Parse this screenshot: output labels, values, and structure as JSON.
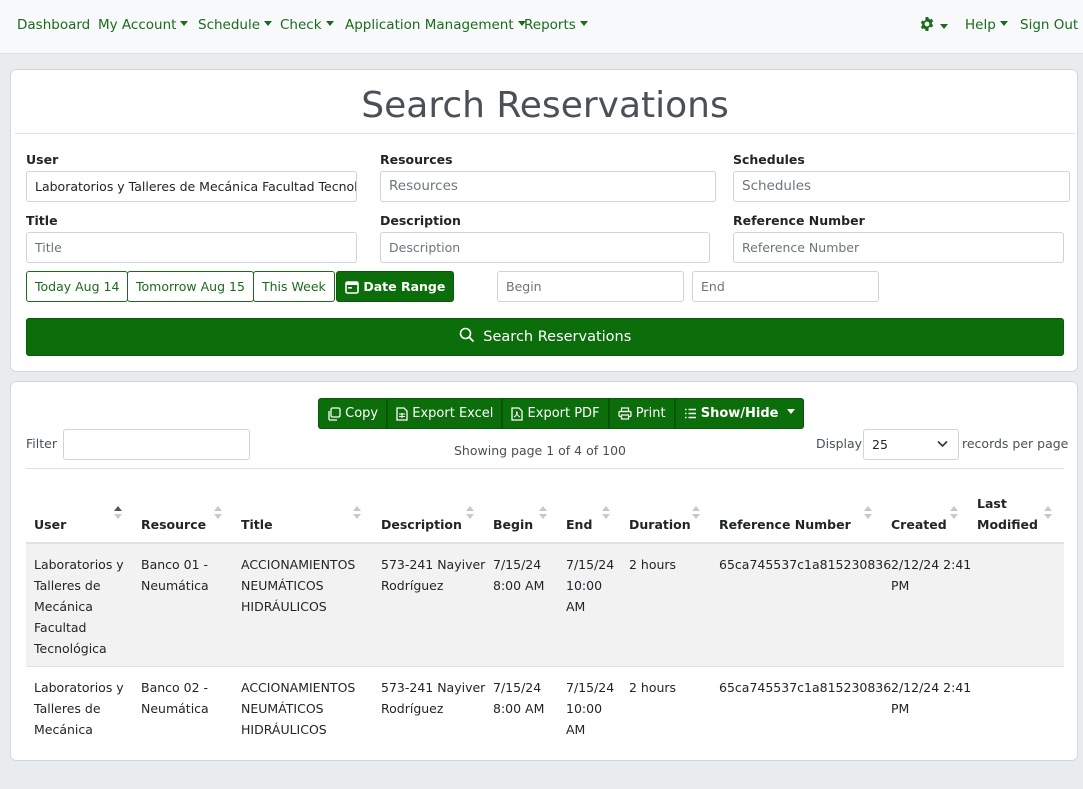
{
  "nav": {
    "dashboard": "Dashboard",
    "my_account": "My Account",
    "schedule": "Schedule",
    "check": "Check",
    "app_mgmt": "Application Management",
    "reports": "Reports",
    "help": "Help",
    "sign_out": "Sign Out"
  },
  "search": {
    "title": "Search Reservations",
    "user_label": "User",
    "user_value": "Laboratorios y Talleres de Mecánica Facultad Tecnológica",
    "resources_label": "Resources",
    "resources_placeholder": "Resources",
    "schedules_label": "Schedules",
    "schedules_placeholder": "Schedules",
    "title_label": "Title",
    "title_placeholder": "Title",
    "description_label": "Description",
    "description_placeholder": "Description",
    "refnum_label": "Reference Number",
    "refnum_placeholder": "Reference Number",
    "today": "Today Aug 14",
    "tomorrow": "Tomorrow Aug 15",
    "this_week": "This Week",
    "date_range": "Date Range",
    "begin_placeholder": "Begin",
    "end_placeholder": "End",
    "search_button": "Search Reservations"
  },
  "results": {
    "toolbar": {
      "copy": "Copy",
      "export_excel": "Export Excel",
      "export_pdf": "Export PDF",
      "print": "Print",
      "show_hide": "Show/Hide"
    },
    "filter_label": "Filter",
    "showing": "Showing page 1 of 4 of 100",
    "display_label": "Display",
    "display_value": "25",
    "records_per_page": "records per page",
    "columns": {
      "user": "User",
      "resource": "Resource",
      "title": "Title",
      "description": "Description",
      "begin": "Begin",
      "end": "End",
      "duration": "Duration",
      "reference": "Reference Number",
      "created": "Created",
      "last_modified_1": "Last",
      "last_modified_2": "Modified"
    },
    "rows": [
      {
        "user": [
          "Laboratorios y",
          "Talleres de",
          "Mecánica",
          "Facultad",
          "Tecnológica"
        ],
        "resource": [
          "Banco 01 -",
          "Neumática"
        ],
        "title": [
          "ACCIONAMIENTOS",
          "NEUMÁTICOS",
          "HIDRÁULICOS"
        ],
        "description": [
          "573-241 Nayiver",
          "Rodríguez"
        ],
        "begin": [
          "7/15/24",
          "8:00 AM"
        ],
        "end": [
          "7/15/24",
          "10:00",
          "AM"
        ],
        "duration": "2 hours",
        "reference": "65ca745537c1a815230836",
        "created": [
          "2/12/24 2:41",
          "PM"
        ],
        "last_modified": ""
      },
      {
        "user": [
          "Laboratorios y",
          "Talleres de",
          "Mecánica"
        ],
        "resource": [
          "Banco 02 -",
          "Neumática"
        ],
        "title": [
          "ACCIONAMIENTOS",
          "NEUMÁTICOS",
          "HIDRÁULICOS"
        ],
        "description": [
          "573-241 Nayiver",
          "Rodríguez"
        ],
        "begin": [
          "7/15/24",
          "8:00 AM"
        ],
        "end": [
          "7/15/24",
          "10:00",
          "AM"
        ],
        "duration": "2 hours",
        "reference": "65ca745537c1a815230836",
        "created": [
          "2/12/24 2:41",
          "PM"
        ],
        "last_modified": ""
      }
    ]
  },
  "colors": {
    "brand_green": "#0b6e0b",
    "link_green": "#1c6b1c"
  }
}
